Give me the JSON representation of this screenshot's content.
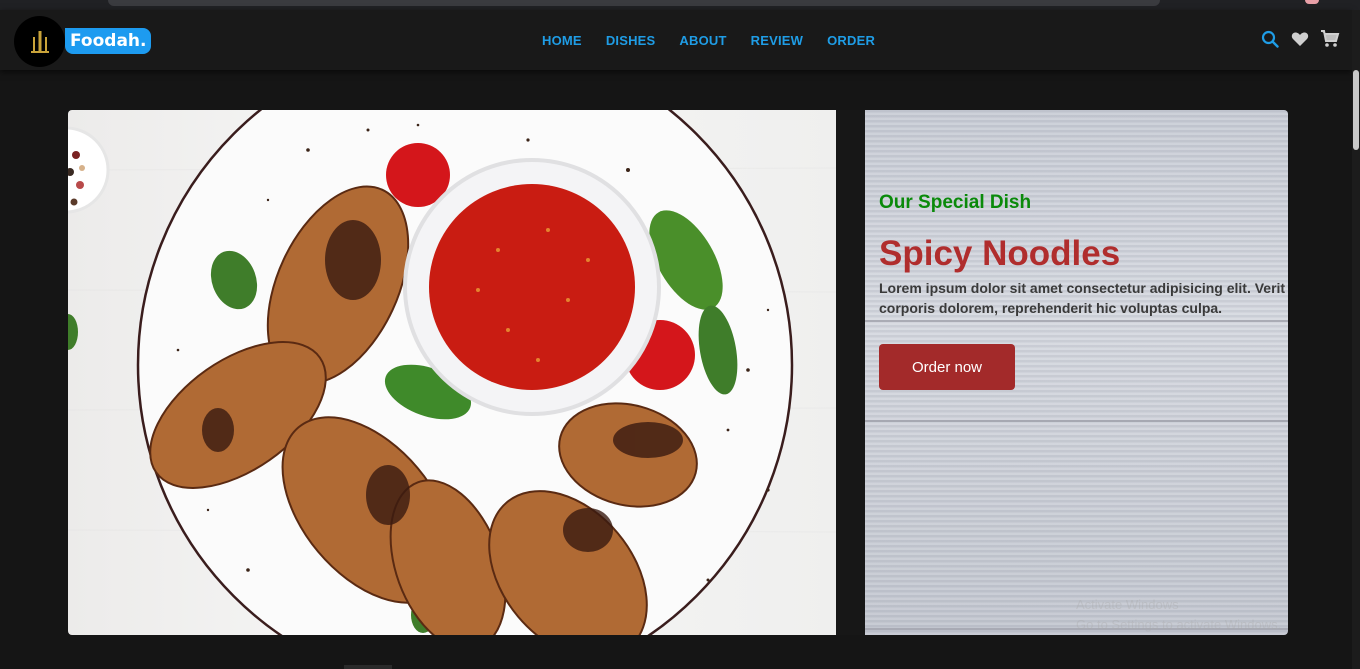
{
  "brand": {
    "name": "Foodah.",
    "colors": {
      "accent": "#1f9de6",
      "badge": "#1d9bf0",
      "green": "#0a8a0a",
      "red": "#b02d2d",
      "button": "#a32a2a"
    }
  },
  "nav": {
    "items": [
      {
        "label": "HOME"
      },
      {
        "label": "DISHES"
      },
      {
        "label": "ABOUT"
      },
      {
        "label": "REVIEW"
      },
      {
        "label": "ORDER"
      }
    ]
  },
  "header_icons": [
    "search-icon",
    "heart-icon",
    "cart-icon"
  ],
  "slide": {
    "subtitle": "Our Special Dish",
    "title": "Spicy Noodles",
    "description_line1": "Lorem ipsum dolor sit amet consectetur adipisicing elit. Verit",
    "description_line2": "corporis dolorem, reprehenderit hic voluptas culpa.",
    "button_label": "Order now"
  },
  "watermark": {
    "line1": "Activate Windows",
    "line2": "Go to Settings to activate Windows."
  }
}
